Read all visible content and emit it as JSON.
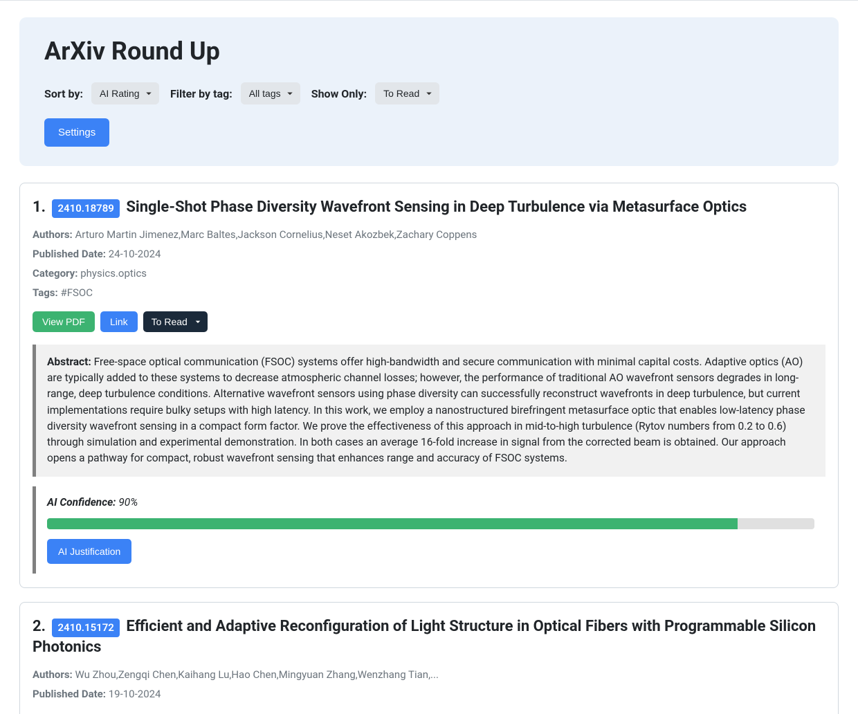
{
  "header": {
    "title": "ArXiv Round Up",
    "sort_label": "Sort by:",
    "sort_value": "AI Rating",
    "filter_label": "Filter by tag:",
    "filter_value": "All tags",
    "show_label": "Show Only:",
    "show_value": "To Read",
    "settings_label": "Settings"
  },
  "labels": {
    "authors": "Authors:",
    "published": "Published Date:",
    "category": "Category:",
    "tags": "Tags:",
    "view_pdf": "View PDF",
    "link": "Link",
    "status_value": "To Read",
    "abstract": "Abstract:",
    "ai_confidence": "AI Confidence:",
    "ai_justification": "AI Justification"
  },
  "papers": [
    {
      "index": "1.",
      "id": "2410.18789",
      "title": "Single-Shot Phase Diversity Wavefront Sensing in Deep Turbulence via Metasurface Optics",
      "authors": "Arturo Martin Jimenez,Marc Baltes,Jackson Cornelius,Neset Akozbek,Zachary Coppens",
      "published": "24-10-2024",
      "category": "physics.optics",
      "tags": "#FSOC",
      "abstract": "Free-space optical communication (FSOC) systems offer high-bandwidth and secure communication with minimal capital costs. Adaptive optics (AO) are typically added to these systems to decrease atmospheric channel losses; however, the performance of traditional AO wavefront sensors degrades in long-range, deep turbulence conditions. Alternative wavefront sensors using phase diversity can successfully reconstruct wavefronts in deep turbulence, but current implementations require bulky setups with high latency. In this work, we employ a nanostructured birefringent metasurface optic that enables low-latency phase diversity wavefront sensing in a compact form factor. We prove the effectiveness of this approach in mid-to-high turbulence (Rytov numbers from 0.2 to 0.6) through simulation and experimental demonstration. In both cases an average 16-fold increase in signal from the corrected beam is obtained. Our approach opens a pathway for compact, robust wavefront sensing that enhances range and accuracy of FSOC systems.",
      "confidence_value": "90%",
      "confidence_pct": 90
    },
    {
      "index": "2.",
      "id": "2410.15172",
      "title": "Efficient and Adaptive Reconfiguration of Light Structure in Optical Fibers with Programmable Silicon Photonics",
      "authors": "Wu Zhou,Zengqi Chen,Kaihang Lu,Hao Chen,Mingyuan Zhang,Wenzhang Tian,...",
      "published": "19-10-2024"
    }
  ]
}
